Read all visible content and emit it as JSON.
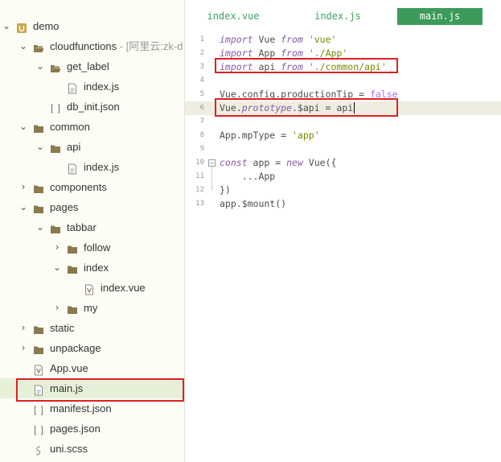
{
  "sidebar": {
    "rows": [
      {
        "label": "demo",
        "suffix": "",
        "type": "project",
        "arrow": "down"
      },
      {
        "label": "cloudfunctions",
        "suffix": " - [阿里云:zk-d",
        "type": "folder-open",
        "arrow": "down"
      },
      {
        "label": "get_label",
        "suffix": "",
        "type": "folder-open",
        "arrow": "down"
      },
      {
        "label": "index.js",
        "suffix": "",
        "type": "js",
        "arrow": ""
      },
      {
        "label": "db_init.json",
        "suffix": "",
        "type": "json",
        "arrow": ""
      },
      {
        "label": "common",
        "suffix": "",
        "type": "folder",
        "arrow": "down"
      },
      {
        "label": "api",
        "suffix": "",
        "type": "folder",
        "arrow": "down"
      },
      {
        "label": "index.js",
        "suffix": "",
        "type": "js",
        "arrow": ""
      },
      {
        "label": "components",
        "suffix": "",
        "type": "folder",
        "arrow": "right"
      },
      {
        "label": "pages",
        "suffix": "",
        "type": "folder",
        "arrow": "down"
      },
      {
        "label": "tabbar",
        "suffix": "",
        "type": "folder",
        "arrow": "down"
      },
      {
        "label": "follow",
        "suffix": "",
        "type": "folder",
        "arrow": "right"
      },
      {
        "label": "index",
        "suffix": "",
        "type": "folder",
        "arrow": "down"
      },
      {
        "label": "index.vue",
        "suffix": "",
        "type": "vue",
        "arrow": ""
      },
      {
        "label": "my",
        "suffix": "",
        "type": "folder",
        "arrow": "right"
      },
      {
        "label": "static",
        "suffix": "",
        "type": "folder",
        "arrow": "right"
      },
      {
        "label": "unpackage",
        "suffix": "",
        "type": "folder",
        "arrow": "right"
      },
      {
        "label": "App.vue",
        "suffix": "",
        "type": "vue",
        "arrow": ""
      },
      {
        "label": "main.js",
        "suffix": "",
        "type": "js",
        "arrow": ""
      },
      {
        "label": "manifest.json",
        "suffix": "",
        "type": "json",
        "arrow": ""
      },
      {
        "label": "pages.json",
        "suffix": "",
        "type": "json",
        "arrow": ""
      },
      {
        "label": "uni.scss",
        "suffix": "",
        "type": "scss",
        "arrow": ""
      }
    ],
    "selected_label": "main.js"
  },
  "tabs": [
    {
      "label": "index.vue",
      "active": false
    },
    {
      "label": "index.js",
      "active": false
    },
    {
      "label": "main.js",
      "active": true
    }
  ],
  "editor": {
    "lines": [
      {
        "num": "1",
        "tokens": [
          [
            "kw",
            "import"
          ],
          [
            "id",
            " Vue "
          ],
          [
            "kw",
            "from"
          ],
          [
            "id",
            " "
          ],
          [
            "str",
            "'vue'"
          ]
        ]
      },
      {
        "num": "2",
        "tokens": [
          [
            "kw",
            "import"
          ],
          [
            "id",
            " App "
          ],
          [
            "kw",
            "from"
          ],
          [
            "id",
            " "
          ],
          [
            "str",
            "'./App'"
          ]
        ]
      },
      {
        "num": "3",
        "tokens": [
          [
            "kw",
            "import"
          ],
          [
            "id",
            " api "
          ],
          [
            "kw",
            "from"
          ],
          [
            "id",
            " "
          ],
          [
            "str",
            "'./common/api'"
          ]
        ]
      },
      {
        "num": "4",
        "tokens": []
      },
      {
        "num": "5",
        "tokens": [
          [
            "id",
            "Vue.config.productionTip = "
          ],
          [
            "bool",
            "false"
          ]
        ]
      },
      {
        "num": "6",
        "tokens": [
          [
            "id",
            "Vue."
          ],
          [
            "attr",
            "prototype"
          ],
          [
            "id",
            ".$api = api"
          ]
        ]
      },
      {
        "num": "7",
        "tokens": []
      },
      {
        "num": "8",
        "tokens": [
          [
            "id",
            "App.mpType = "
          ],
          [
            "str",
            "'app'"
          ]
        ]
      },
      {
        "num": "9",
        "tokens": []
      },
      {
        "num": "10",
        "tokens": [
          [
            "kw",
            "const"
          ],
          [
            "id",
            " app = "
          ],
          [
            "kw",
            "new"
          ],
          [
            "id",
            " Vue({"
          ]
        ]
      },
      {
        "num": "11",
        "tokens": [
          [
            "id",
            "    ...App"
          ]
        ]
      },
      {
        "num": "12",
        "tokens": [
          [
            "id",
            "})"
          ]
        ]
      },
      {
        "num": "13",
        "tokens": [
          [
            "id",
            "app.$mount()"
          ]
        ]
      }
    ],
    "fold_marker": "−"
  },
  "colors": {
    "accent": "#3c9a5b",
    "highlight_box": "#e02020",
    "selected_row": "#e6f0d9"
  }
}
